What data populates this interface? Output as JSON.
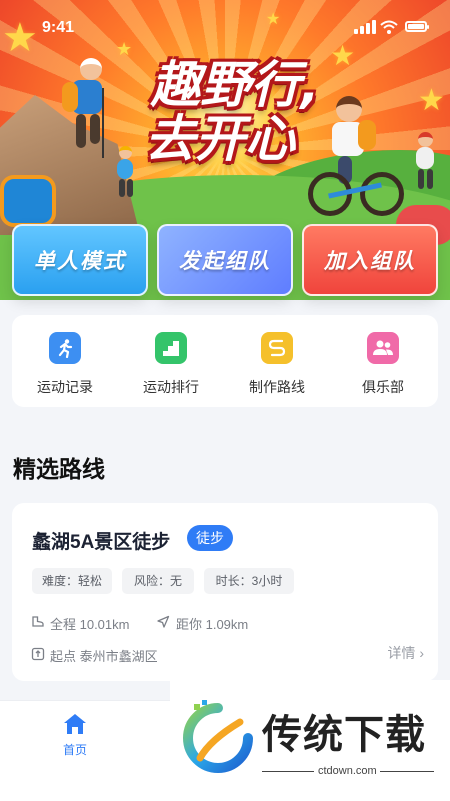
{
  "status_bar": {
    "time": "9:41"
  },
  "banner": {
    "title_line1": "趣野行,",
    "title_line2": "去开心"
  },
  "modes": [
    {
      "label": "单人模式"
    },
    {
      "label": "发起组队"
    },
    {
      "label": "加入组队"
    }
  ],
  "quick_actions": [
    {
      "label": "运动记录",
      "icon": "running-icon",
      "color": "#3d8ff2"
    },
    {
      "label": "运动排行",
      "icon": "ranking-stairs-icon",
      "color": "#34c46a"
    },
    {
      "label": "制作路线",
      "icon": "route-icon",
      "color": "#f5c02b"
    },
    {
      "label": "俱乐部",
      "icon": "club-people-icon",
      "color": "#f06aa8"
    }
  ],
  "section": {
    "title": "精选路线"
  },
  "route_card": {
    "name": "蠡湖5A景区徒步",
    "tag": "徒步",
    "chips": [
      "难度：轻松",
      "风险：无",
      "时长：3小时"
    ],
    "distance": "全程 10.01km",
    "proximity": "距你 1.09km",
    "start": "起点 泰州市蠡湖区",
    "detail": "详情"
  },
  "tabbar": {
    "home_label": "首页"
  },
  "watermark": {
    "text": "传统下载",
    "sub": "ctdown.com"
  },
  "colors": {
    "accent": "#2f7cf6",
    "banner_red": "#e8412e"
  }
}
